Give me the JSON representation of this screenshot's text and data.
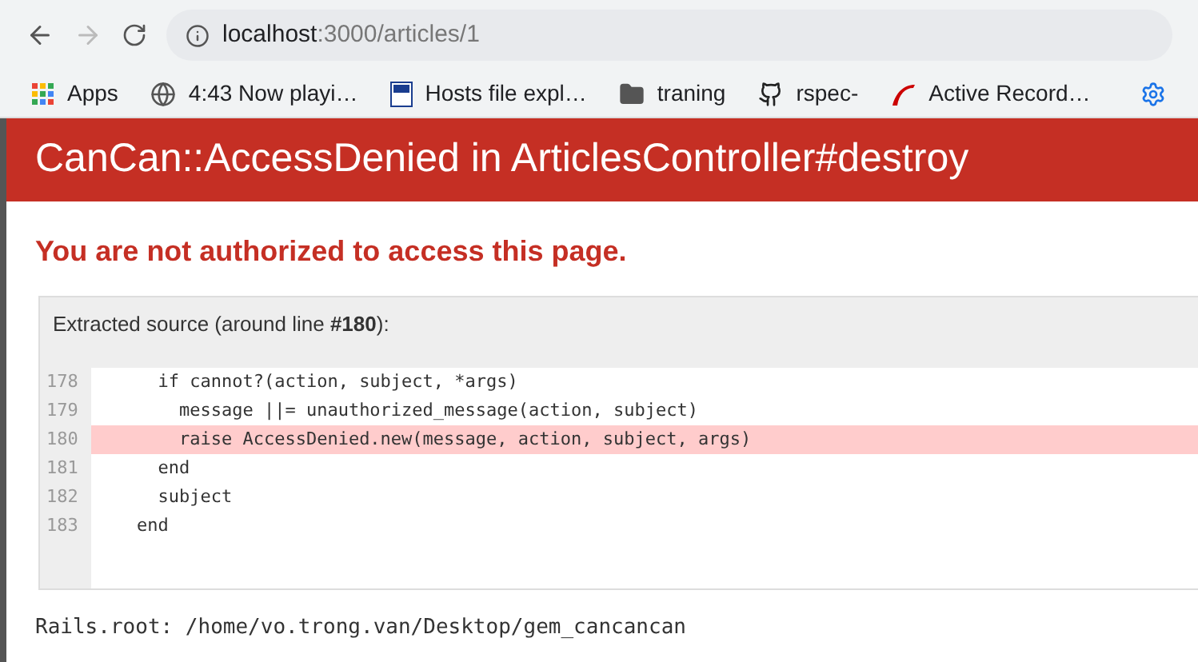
{
  "address_bar": {
    "host": "localhost",
    "path": ":3000/articles/1"
  },
  "bookmarks": [
    {
      "kind": "apps",
      "label": "Apps"
    },
    {
      "kind": "globe",
      "label": "4:43 Now playi…"
    },
    {
      "kind": "page",
      "label": "Hosts file expl…"
    },
    {
      "kind": "folder",
      "label": "traning"
    },
    {
      "kind": "github",
      "label": "rspec-"
    },
    {
      "kind": "rails",
      "label": "Active Record…"
    }
  ],
  "header": {
    "title": "CanCan::AccessDenied in ArticlesController#destroy"
  },
  "message": "You are not authorized to access this page.",
  "source": {
    "caption": "Extracted source (around line **#180**):",
    "lines": [
      {
        "number": "178",
        "code": "      if cannot?(action, subject, *args)",
        "selected": false
      },
      {
        "number": "179",
        "code": "        message ||= unauthorized_message(action, subject)",
        "selected": false
      },
      {
        "number": "180",
        "code": "        raise AccessDenied.new(message, action, subject, args)",
        "selected": true
      },
      {
        "number": "181",
        "code": "      end",
        "selected": false
      },
      {
        "number": "182",
        "code": "      subject",
        "selected": false
      },
      {
        "number": "183",
        "code": "    end",
        "selected": false
      }
    ]
  },
  "rails_root": "Rails.root: /home/vo.trong.van/Desktop/gem_cancancan"
}
